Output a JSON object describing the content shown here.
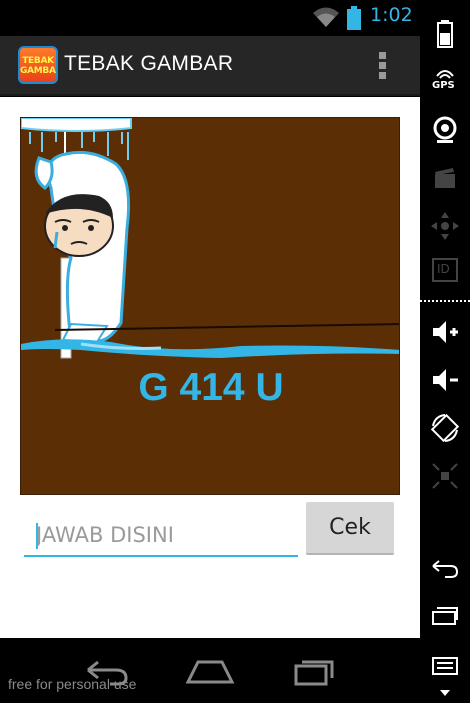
{
  "status_bar": {
    "time": "1:02",
    "accent_color": "#33b5e5",
    "icons": [
      "wifi-icon",
      "battery-icon"
    ]
  },
  "action_bar": {
    "title": "TEBAK GAMBAR",
    "logo_line1": "TEBAK",
    "logo_line2": "GAMBAR",
    "menu_icon": "overflow-menu-icon"
  },
  "puzzle": {
    "image_text": "G 414 U",
    "background_color": "#5c2e06",
    "text_color": "#33b5e5"
  },
  "answer": {
    "placeholder": "JAWAB DISINI",
    "value": ""
  },
  "check_button": {
    "label": "Cek"
  },
  "nav_bar": {
    "buttons": [
      "back-icon",
      "home-icon",
      "recent-apps-icon"
    ]
  },
  "watermark": "free for personal use",
  "side_panel": {
    "buttons": [
      "battery-icon",
      "gps-icon",
      "camera-icon",
      "media-icon",
      "dpad-icon",
      "id-icon",
      "volume-up-icon",
      "volume-down-icon",
      "rotate-icon",
      "scale-icon",
      "back-icon",
      "recent-apps-icon",
      "menu-icon"
    ],
    "gps_label": "GPS",
    "id_label": "ID"
  }
}
